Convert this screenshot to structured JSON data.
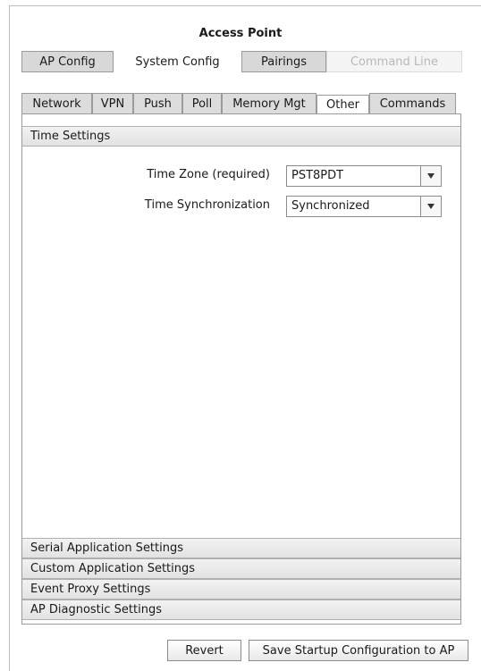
{
  "window": {
    "title": "Access Point"
  },
  "top_tabs": [
    {
      "label": "AP Config",
      "state": "normal"
    },
    {
      "label": "System Config",
      "state": "active"
    },
    {
      "label": "Pairings",
      "state": "normal"
    },
    {
      "label": "Command Line",
      "state": "disabled"
    }
  ],
  "sub_tabs": [
    {
      "label": "Network"
    },
    {
      "label": "VPN"
    },
    {
      "label": "Push"
    },
    {
      "label": "Poll"
    },
    {
      "label": "Memory Mgt"
    },
    {
      "label": "Other",
      "active": true
    },
    {
      "label": "Commands"
    }
  ],
  "time_settings": {
    "header": "Time Settings",
    "time_zone": {
      "label": "Time Zone (required)",
      "value": "PST8PDT"
    },
    "time_sync": {
      "label": "Time Synchronization",
      "value": "Synchronized"
    }
  },
  "collapsed_sections": [
    "Serial Application Settings",
    "Custom Application Settings",
    "Event Proxy Settings",
    "AP Diagnostic Settings"
  ],
  "buttons": {
    "revert": "Revert",
    "save": "Save Startup Configuration to AP"
  },
  "icons": {
    "dropdown": "chevron-down-icon"
  }
}
